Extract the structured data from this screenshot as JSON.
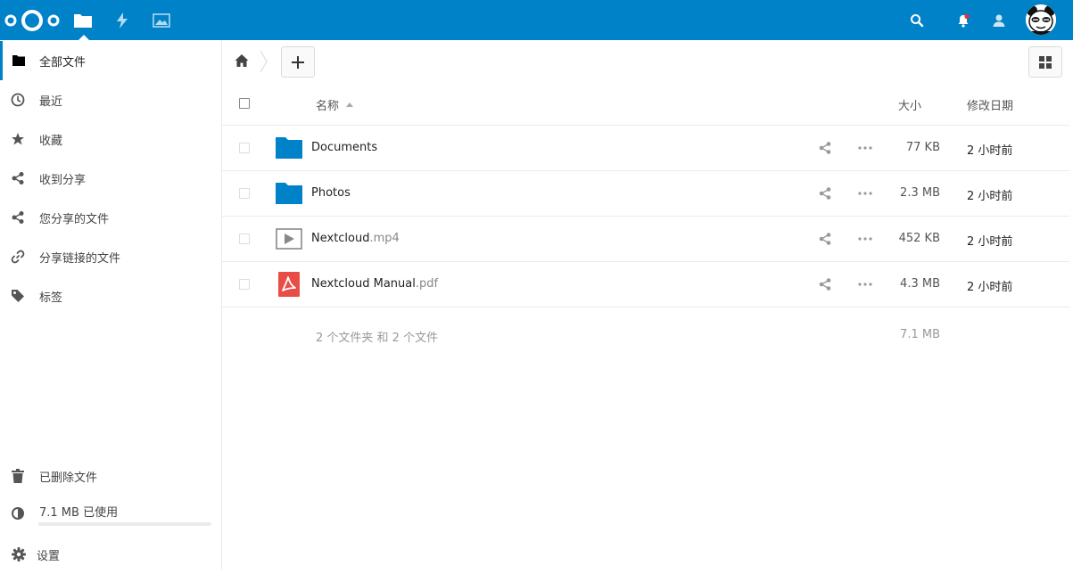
{
  "header": {
    "apps": [
      "files-icon",
      "activity-icon",
      "gallery-icon"
    ],
    "right_icons": [
      "search-icon",
      "notifications-icon",
      "contacts-icon"
    ],
    "colors": {
      "brand": "#0082c9"
    }
  },
  "sidebar": {
    "items": [
      {
        "label": "全部文件",
        "icon": "folder-icon"
      },
      {
        "label": "最近",
        "icon": "clock-icon"
      },
      {
        "label": "收藏",
        "icon": "star-icon"
      },
      {
        "label": "收到分享",
        "icon": "share-icon"
      },
      {
        "label": "您分享的文件",
        "icon": "share-icon"
      },
      {
        "label": "分享链接的文件",
        "icon": "link-icon"
      },
      {
        "label": "标签",
        "icon": "tag-icon"
      }
    ],
    "deleted_label": "已删除文件",
    "quota_label": "7.1 MB 已使用",
    "quota_fraction": 0.0,
    "settings_label": "设置"
  },
  "table": {
    "header": {
      "name": "名称",
      "size": "大小",
      "modified": "修改日期"
    },
    "rows": [
      {
        "name": "Documents",
        "ext": "",
        "type": "folder-icon",
        "size": "77 KB",
        "modified": "2 小时前"
      },
      {
        "name": "Photos",
        "ext": "",
        "type": "folder-icon",
        "size": "2.3 MB",
        "modified": "2 小时前"
      },
      {
        "name": "Nextcloud",
        "ext": ".mp4",
        "type": "video-icon",
        "size": "452 KB",
        "modified": "2 小时前"
      },
      {
        "name": "Nextcloud Manual",
        "ext": ".pdf",
        "type": "pdf-icon",
        "size": "4.3 MB",
        "modified": "2 小时前"
      }
    ],
    "summary": {
      "text": "2 个文件夹 和 2 个文件",
      "size": "7.1 MB"
    }
  }
}
